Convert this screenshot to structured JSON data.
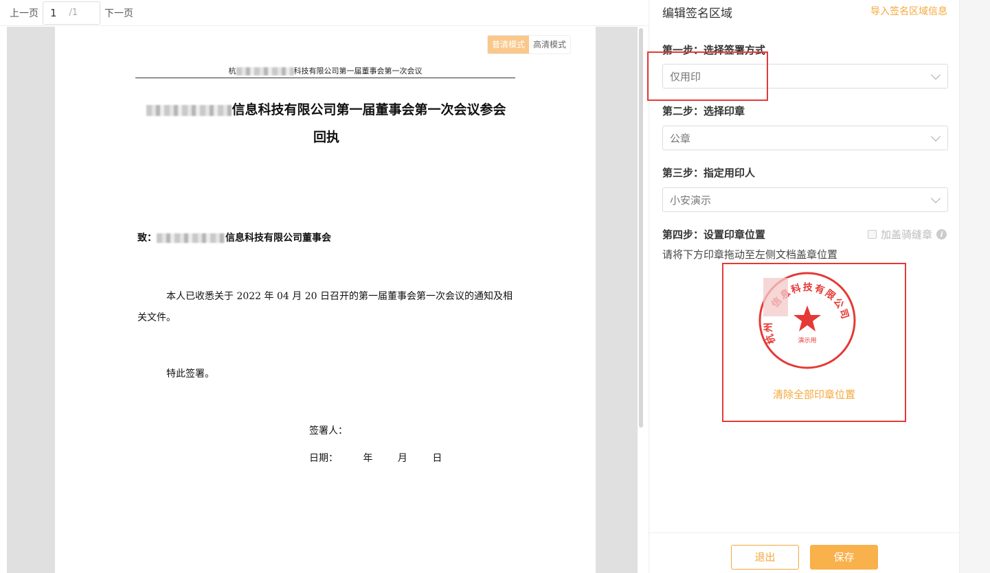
{
  "toolbar": {
    "prev_label": "上一页",
    "current_page": "1",
    "total_pages": "/1",
    "next_label": "下一页"
  },
  "viewer": {
    "modes": [
      "普清模式",
      "高清模式"
    ],
    "active_mode": "普清模式"
  },
  "document": {
    "header_prefix": "杭",
    "header_suffix": "科技有限公司第一届董事会第一次会议",
    "title_line1": "信息科技有限公司第一届董事会第一次会议参会",
    "title_line2": "回执",
    "to_prefix": "致：",
    "to_suffix": "信息科技有限公司董事会",
    "body": "本人已收悉关于 2022 年 04 月 20 日召开的第一届董事会第一次会议的通知及相关文件。",
    "note": "特此签署。",
    "signer": "签署人：",
    "date_label": "日期：",
    "date_year": "年",
    "date_month": "月",
    "date_day": "日"
  },
  "panel": {
    "title": "编辑签名区域",
    "import_link": "导入签名区域信息",
    "step1_label": "第一步：选择签署方式",
    "step1_value": "仅用印",
    "step2_label": "第二步：选择印章",
    "step2_value": "公章",
    "step3_label": "第三步：指定用印人",
    "step3_value": "小安演示",
    "step4_label": "第四步：设置印章位置",
    "riding_seal_label": "加盖骑缝章",
    "hint": "请将下方印章拖动至左侧文档盖章位置",
    "seal_text": "信息科技有限公司",
    "seal_prefix": "杭州",
    "seal_demo": "演示用",
    "clear_link": "清除全部印章位置",
    "exit_label": "退出",
    "save_label": "保存"
  },
  "colors": {
    "accent": "#f5a73b",
    "seal_red": "#e53935",
    "highlight": "#e53935"
  }
}
